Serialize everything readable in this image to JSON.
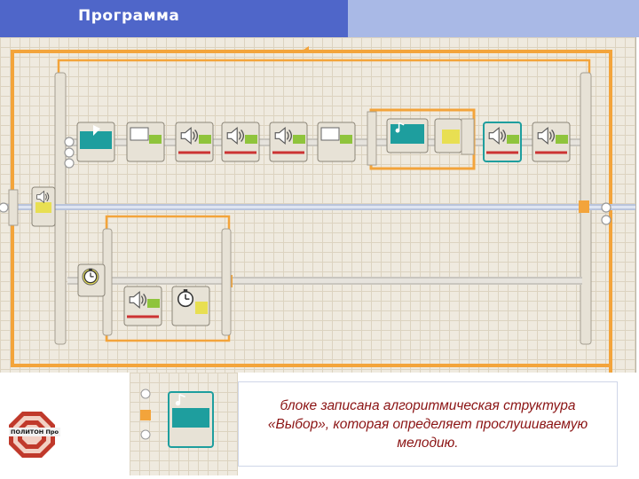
{
  "window": {
    "title": "Программа",
    "accent_dark": "#4f66c9",
    "accent_light": "#a9b9e6"
  },
  "program": {
    "wire_color": "#f3a43b",
    "block_colors": {
      "sound": "#8fc43c",
      "switch": "#1e9e9e",
      "wait": "#e8df52",
      "frame": "#e7e2d6"
    },
    "top_row_blocks": [
      {
        "icon": "switch-icon"
      },
      {
        "icon": "move-icon"
      },
      {
        "icon": "speaker-icon"
      },
      {
        "icon": "speaker-icon"
      },
      {
        "icon": "speaker-icon"
      },
      {
        "icon": "move-icon"
      },
      {
        "icon": "switch-icon"
      },
      {
        "icon": "touch-sensor-icon"
      },
      {
        "icon": "speaker-icon"
      },
      {
        "icon": "speaker-icon"
      }
    ],
    "middle_block": {
      "icon": "speaker-icon"
    },
    "lower_blocks": [
      {
        "icon": "timer-icon"
      },
      {
        "icon": "speaker-icon"
      },
      {
        "icon": "timer-icon"
      }
    ]
  },
  "preview": {
    "icon": "switch-icon"
  },
  "caption": {
    "text": "блоке записана алгоритмическая структура «Выбор», которая определяет прослушиваемую мелодию."
  },
  "logo": {
    "label": "ПОЛИТОН Про",
    "color": "#c0392b"
  }
}
